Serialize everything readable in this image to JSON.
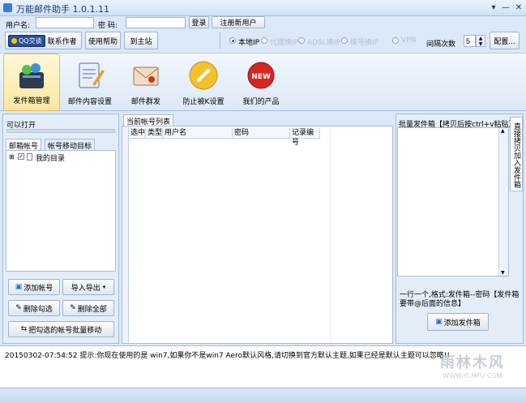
{
  "app": {
    "title": "万能邮件助手 1.0.1.11"
  },
  "login": {
    "username_label": "用户名:",
    "username_value": "",
    "password_label": "密  码:",
    "password_value": "",
    "login_label": "登录",
    "register_label": "注册新用户"
  },
  "toolbar": {
    "qq_label": "QQ交谈",
    "contact_label": "联系作者",
    "help_label": "使用帮助",
    "site_label": "到主站"
  },
  "ip_options": [
    {
      "label": "本地IP",
      "selected": true,
      "enabled": true
    },
    {
      "label": "代理换IP",
      "selected": false,
      "enabled": false
    },
    {
      "label": "ADSL换IP",
      "selected": false,
      "enabled": false
    },
    {
      "label": "拨号换IP",
      "selected": false,
      "enabled": false
    },
    {
      "label": "VPN",
      "selected": false,
      "enabled": false
    }
  ],
  "interval": {
    "label": "间隔次数",
    "value": "5",
    "config_label": "配置..."
  },
  "ribbon": [
    {
      "label": "发件箱管理",
      "icon": "mailbox-users-icon",
      "active": true
    },
    {
      "label": "邮件内容设置",
      "icon": "document-pencil-icon",
      "active": false
    },
    {
      "label": "邮件群发",
      "icon": "envelope-icon",
      "active": false
    },
    {
      "label": "防止被K设置",
      "icon": "wrench-icon",
      "active": false
    },
    {
      "label": "我们的产品",
      "icon": "new-badge-icon",
      "active": false
    }
  ],
  "left": {
    "can_open_label": "可以打开",
    "tabs": [
      "邮箱帐号",
      "帐号移动目标"
    ],
    "tree_root": "我的目录",
    "buttons": {
      "add": "添加帐号",
      "import_export": "导入导出",
      "delete_checked": "删除勾选",
      "delete_all": "删除全部",
      "move_checked": "把勾选的帐号批量移动"
    }
  },
  "center": {
    "tab": "当前帐号列表",
    "columns": [
      "选中",
      "类型",
      "用户名",
      "密码",
      "记录编号"
    ]
  },
  "right": {
    "header": "批量发件箱【拷贝后按ctrl+v粘贴】",
    "side_tab": "直接拷贝加入发件箱",
    "hint": "一行一个,格式:发件箱--密码【发件箱要带@后面的信息】",
    "add_button": "添加发件箱"
  },
  "status": {
    "message": "20150302-07:54:52  提示:你现在使用的是 win7,如果你不是win7 Aero默认风格,请切换到官方默认主题,如果已经是默认主题可以忽略!!"
  },
  "watermark": {
    "brand": "雨林木风",
    "url": "WWW.YLMFU.COM"
  }
}
